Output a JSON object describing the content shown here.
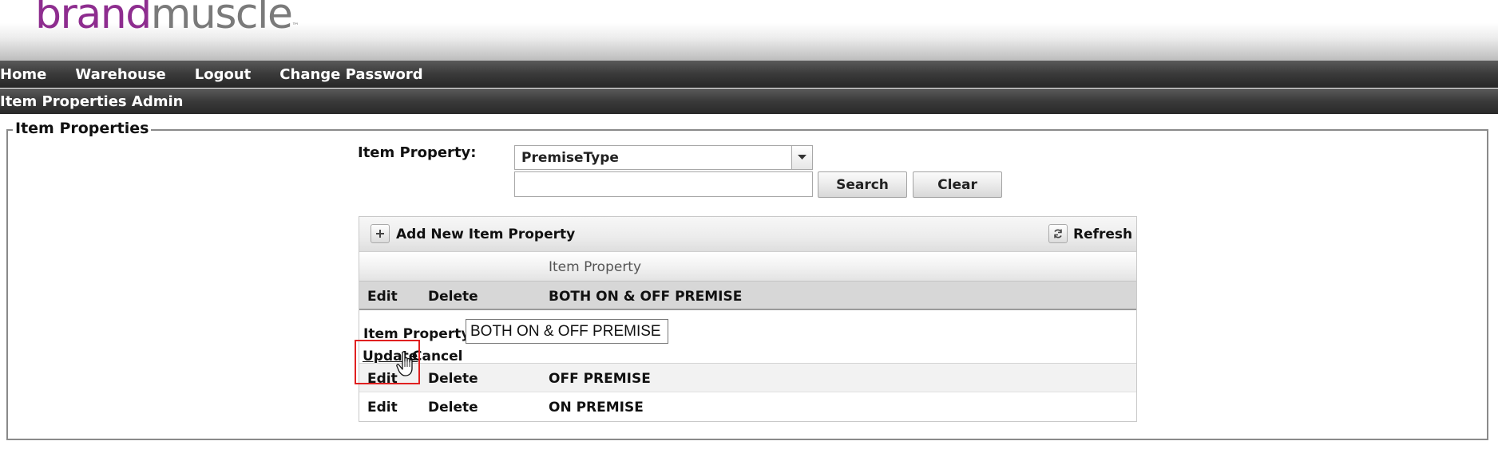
{
  "header": {
    "logo_brand": "brand",
    "logo_muscle": "muscle",
    "logo_tm": "™"
  },
  "nav": {
    "items": [
      "Home",
      "Warehouse",
      "Logout",
      "Change Password"
    ]
  },
  "page": {
    "title": "Item Properties Admin"
  },
  "fieldset": {
    "legend": "Item Properties"
  },
  "filter": {
    "label": "Item Property:",
    "selected": "PremiseType",
    "search_value": "",
    "search_button": "Search",
    "clear_button": "Clear"
  },
  "grid": {
    "add_label": "Add New Item Property",
    "refresh_label": "Refresh",
    "column_header": "Item Property",
    "edit_label": "Edit",
    "delete_label": "Delete",
    "rows": [
      {
        "value": "BOTH ON & OFF PREMISE"
      },
      {
        "value": "OFF PREMISE"
      },
      {
        "value": "ON PREMISE"
      }
    ],
    "editor": {
      "label": "Item Property:",
      "value": "BOTH ON & OFF PREMISE",
      "update_label": "Update",
      "cancel_label": "Cancel"
    }
  },
  "colors": {
    "brand_purple": "#8e2d8f",
    "brand_gray": "#7a7a7a",
    "navbar": "#3c3c3c",
    "highlight": "#e02020"
  },
  "icons": {
    "add": "plus-icon",
    "refresh": "refresh-icon",
    "dropdown": "chevron-down-icon",
    "cursor": "hand-pointer-icon"
  }
}
